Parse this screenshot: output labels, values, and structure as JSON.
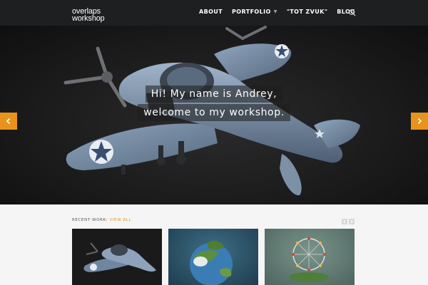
{
  "brand": {
    "line1": "overlaps",
    "line2": "workshop"
  },
  "nav": {
    "items": [
      {
        "label": "ABOUT"
      },
      {
        "label": "PORTFOLIO"
      },
      {
        "label": "\"TOT ZVUK\""
      },
      {
        "label": "BLOG"
      }
    ]
  },
  "hero": {
    "line1": "Hi! My name is Andrey,",
    "line2": "welcome to my workshop."
  },
  "recent": {
    "title": "RECENT WORK",
    "separator": "/",
    "view_all": "VIEW ALL"
  },
  "colors": {
    "accent": "#e8931c",
    "header_bg": "#1e1f21"
  }
}
